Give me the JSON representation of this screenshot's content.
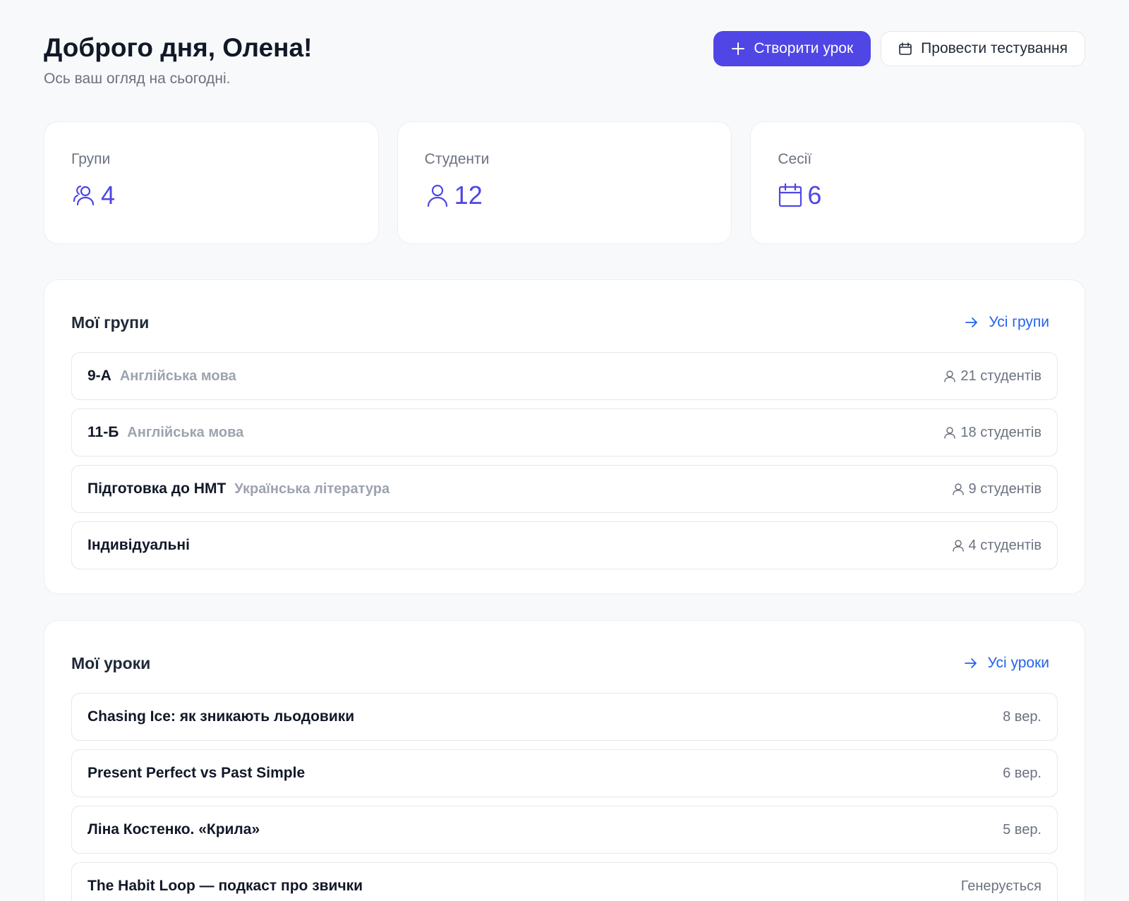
{
  "header": {
    "title": "Доброго дня, Олена!",
    "subtitle": "Ось ваш огляд на сьогодні.",
    "create_lesson_label": "Створити урок",
    "run_test_label": "Провести тестування"
  },
  "stats": [
    {
      "label": "Групи",
      "value": "4",
      "icon": "users-icon"
    },
    {
      "label": "Студенти",
      "value": "12",
      "icon": "user-icon"
    },
    {
      "label": "Сесії",
      "value": "6",
      "icon": "calendar-icon"
    }
  ],
  "groups": {
    "title": "Мої групи",
    "link_label": "Усі групи",
    "items": [
      {
        "name": "9-А",
        "subject": "Англійська мова",
        "students": "21 студентів"
      },
      {
        "name": "11-Б",
        "subject": "Англійська мова",
        "students": "18 студентів"
      },
      {
        "name": "Підготовка до НМТ",
        "subject": "Українська література",
        "students": "9 студентів"
      },
      {
        "name": "Індивідуальні",
        "subject": "",
        "students": "4 студентів"
      }
    ]
  },
  "lessons": {
    "title": "Мої уроки",
    "link_label": "Усі уроки",
    "items": [
      {
        "name": "Chasing Ice: як зникають льодовики",
        "meta": "8 вер."
      },
      {
        "name": "Present Perfect vs Past Simple",
        "meta": "6 вер."
      },
      {
        "name": "Ліна Костенко. «Крила»",
        "meta": "5 вер."
      },
      {
        "name": "The Habit Loop — подкаст про звички",
        "meta": "Генерується"
      }
    ]
  },
  "colors": {
    "accent": "#4f46e5",
    "link": "#2563eb",
    "background": "#f8f9fb"
  }
}
